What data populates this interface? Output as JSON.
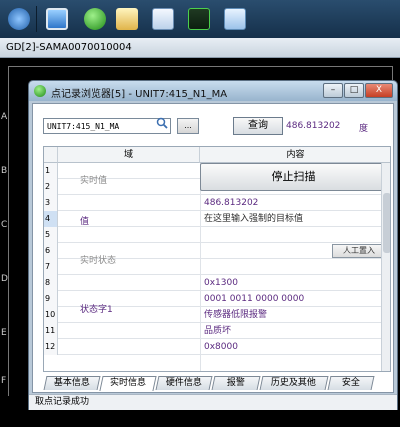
{
  "doc_tab": {
    "title": "GD[2]-SAMA0070010004"
  },
  "canvas": {
    "ruler_labels": [
      "A",
      "B",
      "C",
      "D",
      "E",
      "F"
    ]
  },
  "dialog": {
    "title": "点记录浏览器[5] - UNIT7:415_N1_MA",
    "minimize": "–",
    "maximize": "□",
    "close": "X",
    "search_value": "UNIT7:415_N1_MA",
    "browse_label": "...",
    "query_label": "查询",
    "query_value": "486.813202",
    "query_unit": "度",
    "table": {
      "col_name": "域",
      "col_content": "内容",
      "row_numbers": [
        "1",
        "2",
        "3",
        "4",
        "5",
        "6",
        "7",
        "8",
        "9",
        "10",
        "11",
        "12"
      ],
      "labels": {
        "realtime_value": "实时值",
        "value": "值",
        "realtime_status": "实时状态",
        "status_word": "状态字1"
      },
      "stop_scan": "停止扫描",
      "rows": {
        "r3": "486.813202",
        "r4": "在这里输入强制的目标值",
        "r8": "0x1300",
        "r9": "0001 0011 0000 0000",
        "r10": "传感器低限报警",
        "r11": "品质坏",
        "r12": "0x8000"
      },
      "manual_set": "人工置入"
    },
    "tabs": [
      "基本信息",
      "实时信息",
      "硬件信息",
      "报警",
      "历史及其他",
      "安全"
    ],
    "status": "取点记录成功"
  }
}
